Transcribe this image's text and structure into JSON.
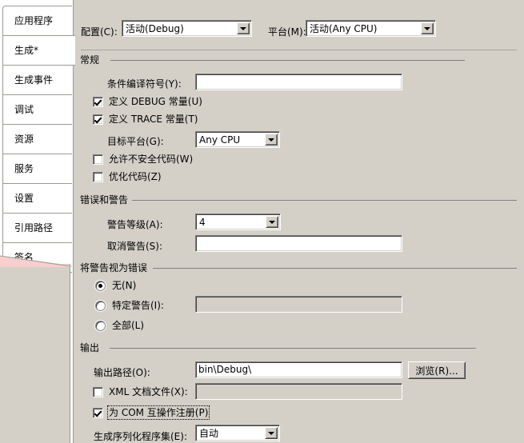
{
  "sidebar": {
    "items": [
      {
        "label": "应用程序",
        "selected": false
      },
      {
        "label": "生成*",
        "selected": true
      },
      {
        "label": "生成事件",
        "selected": false
      },
      {
        "label": "调试",
        "selected": false
      },
      {
        "label": "资源",
        "selected": false
      },
      {
        "label": "服务",
        "selected": false
      },
      {
        "label": "设置",
        "selected": false
      },
      {
        "label": "引用路径",
        "selected": false
      },
      {
        "label": "签名",
        "selected": false
      }
    ],
    "wedge_color": "#f7cfcf"
  },
  "header": {
    "configuration_label": "配置(C):",
    "configuration_value": "活动(Debug)",
    "platform_label": "平台(M):",
    "platform_value": "活动(Any CPU)"
  },
  "general": {
    "title": "常规",
    "conditional_symbols_label": "条件编译符号(Y):",
    "conditional_symbols_value": "",
    "define_debug_label": "定义 DEBUG 常量(U)",
    "define_debug_checked": true,
    "define_trace_label": "定义 TRACE 常量(T)",
    "define_trace_checked": true,
    "target_platform_label": "目标平台(G):",
    "target_platform_value": "Any CPU",
    "allow_unsafe_label": "允许不安全代码(W)",
    "allow_unsafe_checked": false,
    "optimize_code_label": "优化代码(Z)",
    "optimize_code_checked": false
  },
  "errors_warnings": {
    "title": "错误和警告",
    "warning_level_label": "警告等级(A):",
    "warning_level_value": "4",
    "suppress_warnings_label": "取消警告(S):",
    "suppress_warnings_value": ""
  },
  "treat_warnings": {
    "title": "将警告视为错误",
    "none_label": "无(N)",
    "specific_label": "特定警告(I):",
    "specific_value": "",
    "all_label": "全部(L)",
    "selected": "none"
  },
  "output": {
    "title": "输出",
    "output_path_label": "输出路径(O):",
    "output_path_value": "bin\\Debug\\",
    "browse_label": "浏览(R)...",
    "xml_doc_label": "XML 文档文件(X):",
    "xml_doc_checked": false,
    "xml_doc_value": "",
    "register_com_label": "为 COM 互操作注册(P)",
    "register_com_checked": true,
    "serialization_label": "生成序列化程序集(E):",
    "serialization_value": "自动"
  }
}
